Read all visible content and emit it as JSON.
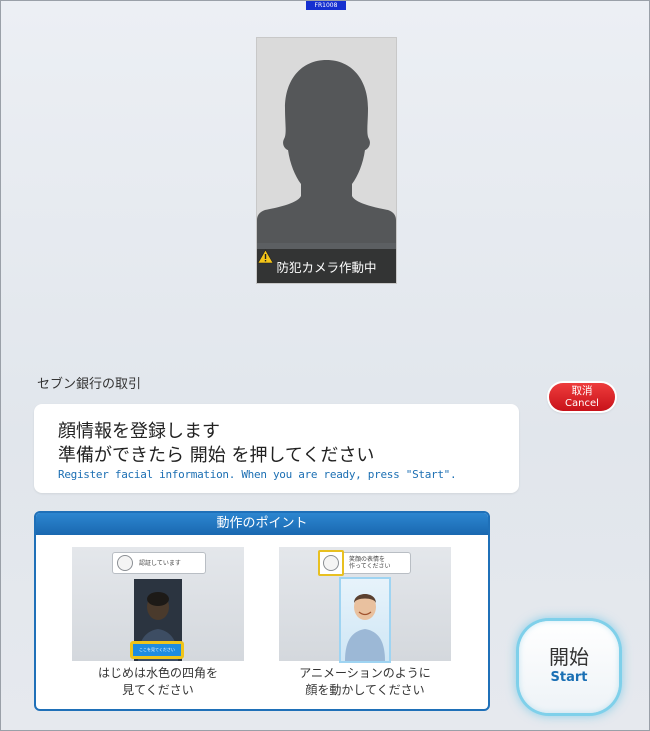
{
  "screen": {
    "id": "FR1008"
  },
  "camera": {
    "badge_text": "防犯カメラ作動中",
    "warning_icon": "warning-triangle-icon"
  },
  "transaction": {
    "label": "セブン銀行の取引"
  },
  "cancel_button": {
    "label_jp": "取消",
    "label_en": "Cancel"
  },
  "message": {
    "line1": "顔情報を登録します",
    "line2": "準備ができたら 開始 を押してください",
    "line3_en": "Register facial information. When you are ready, press \"Start\"."
  },
  "points": {
    "title": "動作のポイント",
    "cards": [
      {
        "bubble_text": "認証しています",
        "square_text": "ここを見てください",
        "caption_line1": "はじめは水色の四角を",
        "caption_line2": "見てください"
      },
      {
        "bubble_text_line1": "笑顔の表情を",
        "bubble_text_line2": "作ってください",
        "caption_line1": "アニメーションのように",
        "caption_line2": "顔を動かしてください"
      }
    ]
  },
  "start_button": {
    "label_jp": "開始",
    "label_en": "Start"
  },
  "colors": {
    "accent_blue": "#1f70b8",
    "cancel_red": "#d9232a",
    "start_glow": "#7fd0ea",
    "highlight_yellow": "#f0c419"
  }
}
